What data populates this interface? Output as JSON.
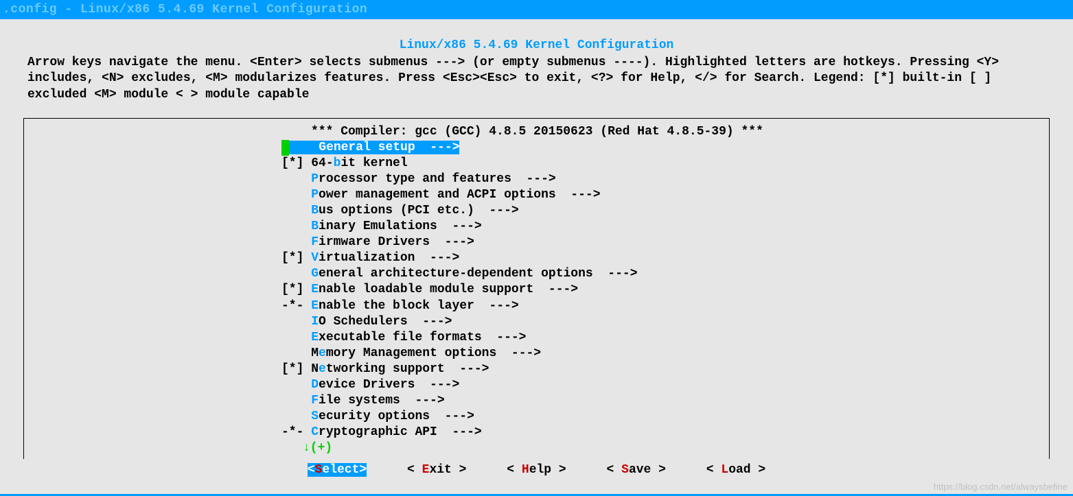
{
  "titlebar": ".config - Linux/x86 5.4.69 Kernel Configuration",
  "header_title": "Linux/x86 5.4.69 Kernel Configuration",
  "help_text": "Arrow keys navigate the menu.  <Enter> selects submenus ---> (or empty submenus ----).  Highlighted letters are hotkeys.  Pressing <Y> includes, <N> excludes, <M> modularizes features.  Press <Esc><Esc> to exit, <?> for Help, </> for Search.  Legend: [*] built-in  [ ] excluded  <M> module  < > module capable",
  "compiler_info": "*** Compiler: gcc (GCC) 4.8.5 20150623 (Red Hat 4.8.5-39) ***",
  "menu_items": [
    {
      "prefix": "   ",
      "hotkey": "G",
      "rest": "eneral setup  --->",
      "selected": true
    },
    {
      "prefix": "[*]",
      "pre": "64-",
      "hotkey": "b",
      "rest": "it kernel"
    },
    {
      "prefix": "   ",
      "hotkey": "P",
      "rest": "rocessor type and features  --->"
    },
    {
      "prefix": "   ",
      "hotkey": "P",
      "rest": "ower management and ACPI options  --->"
    },
    {
      "prefix": "   ",
      "hotkey": "B",
      "rest": "us options (PCI etc.)  --->"
    },
    {
      "prefix": "   ",
      "hotkey": "B",
      "rest": "inary Emulations  --->"
    },
    {
      "prefix": "   ",
      "hotkey": "F",
      "rest": "irmware Drivers  --->"
    },
    {
      "prefix": "[*]",
      "hotkey": "V",
      "rest": "irtualization  --->"
    },
    {
      "prefix": "   ",
      "hotkey": "G",
      "rest": "eneral architecture-dependent options  --->"
    },
    {
      "prefix": "[*]",
      "hotkey": "E",
      "rest": "nable loadable module support  --->"
    },
    {
      "prefix": "-*-",
      "hotkey": "E",
      "rest": "nable the block layer  --->"
    },
    {
      "prefix": "   ",
      "hotkey": "I",
      "rest": "O Schedulers  --->"
    },
    {
      "prefix": "   ",
      "hotkey": "E",
      "rest": "xecutable file formats  --->"
    },
    {
      "prefix": "   ",
      "pre": "M",
      "hotkey": "e",
      "rest": "mory Management options  --->"
    },
    {
      "prefix": "[*]",
      "pre": "N",
      "hotkey": "e",
      "rest": "tworking support  --->"
    },
    {
      "prefix": "   ",
      "hotkey": "D",
      "rest": "evice Drivers  --->"
    },
    {
      "prefix": "   ",
      "hotkey": "F",
      "rest": "ile systems  --->"
    },
    {
      "prefix": "   ",
      "hotkey": "S",
      "rest": "ecurity options  --->"
    },
    {
      "prefix": "-*-",
      "hotkey": "C",
      "rest": "ryptographic API  --->"
    }
  ],
  "more_indicator": "↓(+)",
  "buttons": {
    "select": {
      "open": "<",
      "hk": "S",
      "rest": "elect>",
      "active": true
    },
    "exit": {
      "open": "< ",
      "hk": "E",
      "rest": "xit >"
    },
    "help": {
      "open": "< ",
      "hk": "H",
      "rest": "elp >"
    },
    "save": {
      "open": "< ",
      "hk": "S",
      "rest": "ave >"
    },
    "load": {
      "open": "< ",
      "hk": "L",
      "rest": "oad >"
    }
  },
  "watermark": "https://blog.csdn.net/alwaysbefine"
}
